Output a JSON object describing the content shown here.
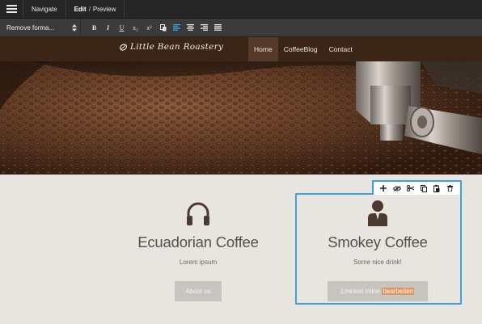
{
  "editor": {
    "tabs": [
      {
        "label": "Navigate"
      },
      {
        "label_bold": "Edit",
        "separator": "/",
        "label_rest": "Preview"
      }
    ]
  },
  "toolbar": {
    "format_select": "Remove forma...",
    "bold": "B",
    "italic": "I",
    "underline": "U",
    "subscript": "x₂",
    "superscript": "x²",
    "active_color": "#39a5e0"
  },
  "site": {
    "logo_text": "Little Bean Roastery",
    "nav": [
      "Home",
      "CoffeeBlog",
      "Contact"
    ],
    "brand_color": "#3a2517"
  },
  "cards": [
    {
      "title": "Ecuadorian Coffee",
      "subtitle": "Lorem ipsum",
      "button": "About us",
      "icon": "headphones-icon"
    },
    {
      "title": "Smokey Coffee",
      "subtitle": "Some nice drink!",
      "button_text": "Linktext inline",
      "button_highlight": "bearbeiten",
      "icon": "person-icon"
    }
  ],
  "element_toolbar": {
    "icons": [
      "add-icon",
      "visibility-icon",
      "cut-icon",
      "copy-icon",
      "paste-icon",
      "delete-icon"
    ],
    "selection_color": "#3ea2d8"
  }
}
